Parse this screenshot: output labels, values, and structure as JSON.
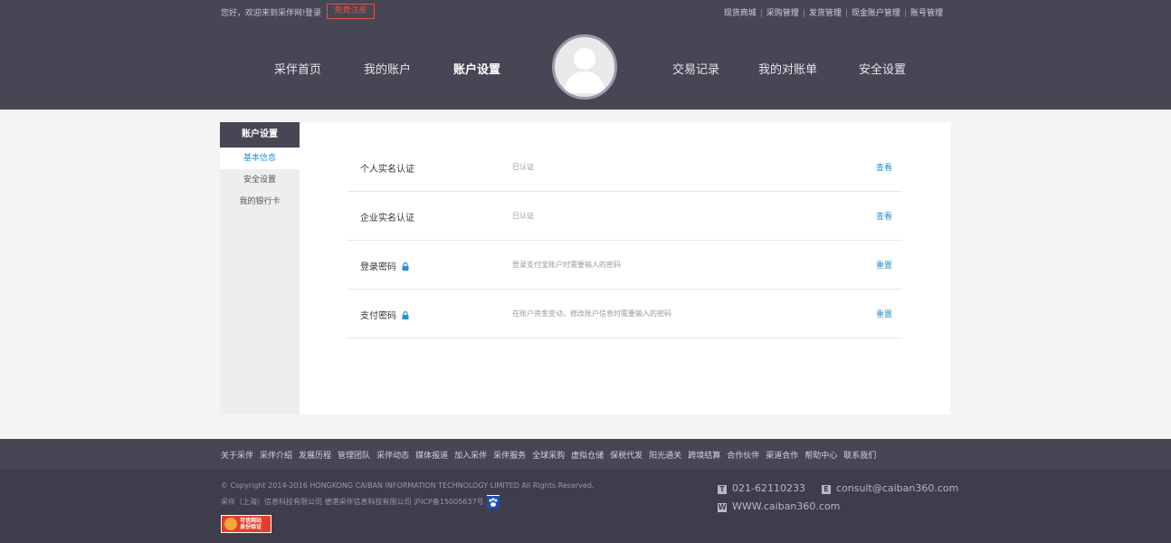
{
  "topbar": {
    "greeting": "您好，欢迎来到采伴网!",
    "login": "登录",
    "register": "免费注册",
    "links": [
      "现货商城",
      "采购管理",
      "发货管理",
      "现金账户管理",
      "账号管理"
    ]
  },
  "nav": {
    "items": [
      "采伴首页",
      "我的账户",
      "账户设置",
      "交易记录",
      "我的对账单",
      "安全设置"
    ],
    "active": "账户设置"
  },
  "sidebar": {
    "title": "账户设置",
    "items": [
      "基本信息",
      "安全设置",
      "我的银行卡"
    ]
  },
  "settings": [
    {
      "label": "个人实名认证",
      "desc": "已认证",
      "action": "查看",
      "locked": false
    },
    {
      "label": "企业实名认证",
      "desc": "已认证",
      "action": "查看",
      "locked": false
    },
    {
      "label": "登录密码",
      "desc": "登录支付宝账户时需要输入的密码",
      "action": "重置",
      "locked": true
    },
    {
      "label": "支付密码",
      "desc": "在账户资金变动，修改账户信息时需要输入的密码",
      "action": "重置",
      "locked": true
    }
  ],
  "footer": {
    "links": [
      "关于采伴",
      "采伴介绍",
      "发展历程",
      "管理团队",
      "采伴动态",
      "媒体报道",
      "加入采伴",
      "采伴服务",
      "全球采购",
      "虚拟仓储",
      "保税代发",
      "阳光通关",
      "跨境结算",
      "合作伙伴",
      "渠道合作",
      "帮助中心",
      "联系我们"
    ],
    "copyright": "© Copyright 2014-2016 HONGKONG CAIBAN INFORMATION TECHNOLOGY LIMITED All Rights Reserved.",
    "company": "采伴（上海）信息科技有限公司 德港采伴信息科技有限公司 沪ICP备15005637号",
    "badge_line1": "可信网站",
    "badge_line2": "身份验证",
    "phone_icon": "T",
    "phone": "021-62110233",
    "email_icon": "E",
    "email": "consult@caiban360.com",
    "web_icon": "W",
    "website": "WWW.caiban360.com"
  },
  "colors": {
    "header_bg": "#464655",
    "accent_blue": "#2a8fd0",
    "register_red": "#e2523f"
  }
}
